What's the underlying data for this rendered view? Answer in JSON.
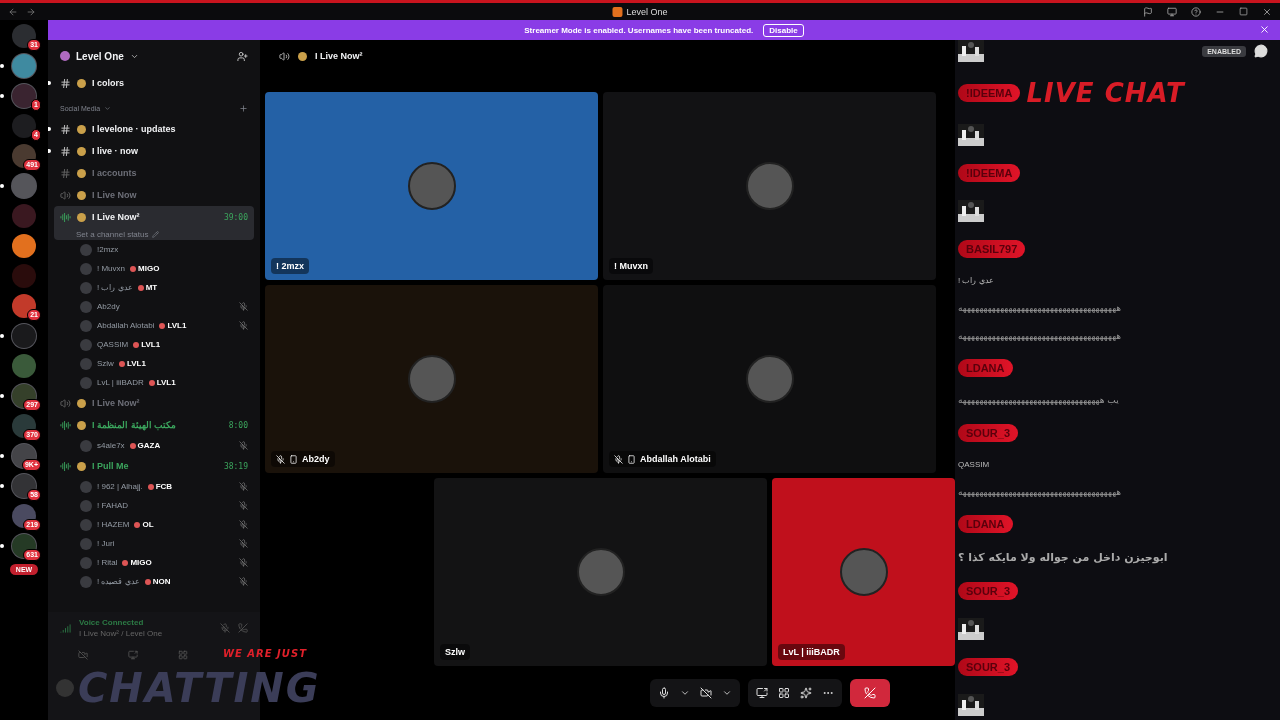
{
  "titlebar": {
    "title": "Level One"
  },
  "banner": {
    "message": "Streamer Mode is enabled. Usernames have been truncated.",
    "button": "Disable"
  },
  "servers": [
    {
      "badge": "31",
      "unread": false,
      "color": "#2b2d31"
    },
    {
      "unread": true,
      "color": "#3f8aa0"
    },
    {
      "badge": "1",
      "unread": true,
      "color": "#3a2430"
    },
    {
      "badge": "4",
      "unread": false,
      "color": "#1d1d20"
    },
    {
      "badge": "491",
      "unread": false,
      "color": "#4a3a30"
    },
    {
      "unread": true,
      "color": "#55555a"
    },
    {
      "unread": false,
      "color": "#3a1820"
    },
    {
      "unread": false,
      "color": "#e2701e"
    },
    {
      "unread": false,
      "color": "#2a0c0c"
    },
    {
      "badge": "21",
      "unread": false,
      "color": "#c23a2a"
    },
    {
      "unread": true,
      "color": "#1a1a1c"
    },
    {
      "unread": false,
      "color": "#3a5a3a"
    },
    {
      "badge": "297",
      "unread": true,
      "color": "#35402a"
    },
    {
      "badge": "370",
      "unread": false,
      "color": "#2a3a3a"
    },
    {
      "badge": "9K+",
      "unread": true,
      "color": "#444448"
    },
    {
      "badge": "58",
      "unread": true,
      "color": "#333336"
    },
    {
      "badge": "219",
      "unread": false,
      "color": "#4a4a60"
    },
    {
      "badge": "631",
      "unread": true,
      "color": "#253a25"
    }
  ],
  "servers_new": "NEW",
  "sidebar": {
    "server_name": "Level One",
    "channels": [
      {
        "kind": "text",
        "name": "I colors",
        "unread": true
      },
      {
        "kind": "category",
        "name": "Social Media"
      },
      {
        "kind": "text",
        "name": "I levelone · updates",
        "unread": true
      },
      {
        "kind": "text",
        "name": "I live · now",
        "unread": true
      },
      {
        "kind": "text",
        "name": "I accounts",
        "unread": false
      },
      {
        "kind": "voice",
        "name": "I Live Now",
        "active": false,
        "selected": false
      },
      {
        "kind": "voice",
        "name": "I Live Now²",
        "active": true,
        "selected": true,
        "timer": "39:00",
        "status": "Set a channel status",
        "members": [
          {
            "name": "!2mzx",
            "deafened": false
          },
          {
            "name": "! Muvxn",
            "tag": "MIGO",
            "deafened": false
          },
          {
            "name": "! عدي راب",
            "tag": "MT",
            "deafened": false
          },
          {
            "name": "Ab2dy",
            "deafened": true
          },
          {
            "name": "Abdallah Alotabi",
            "tag": "LVL1",
            "deafened": true
          },
          {
            "name": "QASSIM",
            "tag": "LVL1",
            "deafened": false
          },
          {
            "name": "Szlw",
            "tag": "LVL1",
            "deafened": false
          },
          {
            "name": "LvL | iiiBADR",
            "tag": "LVL1",
            "deafened": false
          }
        ]
      },
      {
        "kind": "voice",
        "name": "I Live Now²",
        "active": false,
        "selected": false
      },
      {
        "kind": "voice",
        "name": "I مكتب الهيئة المنظمة",
        "active": true,
        "selected": false,
        "timer": "8:00",
        "members": [
          {
            "name": "s4ale7x",
            "tag": "GAZA",
            "deafened": true
          }
        ]
      },
      {
        "kind": "voice",
        "name": "I Pull Me",
        "active": true,
        "selected": false,
        "timer": "38:19",
        "members": [
          {
            "name": "! 962 | Alhajj.",
            "tag": "FCB",
            "deafened": true
          },
          {
            "name": "! FAHAD",
            "deafened": true
          },
          {
            "name": "! HAZEM",
            "tag": "OL",
            "deafened": true
          },
          {
            "name": "! Juri",
            "deafened": true
          },
          {
            "name": "! Rital",
            "tag": "MIGO",
            "deafened": true
          },
          {
            "name": "! عدي قصيده",
            "tag": "NON",
            "deafened": true
          }
        ]
      }
    ],
    "voice_panel": {
      "status": "Voice Connected",
      "location": "I Live Now² / Level One"
    },
    "overlay": {
      "tagline": "WE ARE JUST",
      "title": "CHATTING"
    }
  },
  "main": {
    "channel": "I Live Now²",
    "rows": [
      {
        "tiles": [
          {
            "name": "! 2mzx",
            "color": "#2461a6",
            "muted": false,
            "mobile": false
          },
          {
            "name": "! Muvxn",
            "color": "#121214",
            "muted": false,
            "mobile": false
          }
        ]
      },
      {
        "tiles": [
          {
            "name": "Ab2dy",
            "color": "#1a120a",
            "muted": true,
            "mobile": true
          },
          {
            "name": "Abdallah Alotabi",
            "color": "#0f0f10",
            "muted": true,
            "mobile": true
          }
        ]
      },
      {
        "tiles": [
          {
            "name": "Szlw",
            "color": "#131314",
            "muted": false,
            "mobile": false
          },
          {
            "name": "LvL | iiiBADR",
            "color": "#c0101c",
            "muted": false,
            "mobile": false
          }
        ]
      }
    ]
  },
  "chat": {
    "badge": "ENABLED",
    "title": "LIVE CHAT",
    "entries": [
      {
        "kind": "sticker"
      },
      {
        "kind": "name",
        "text": "!IDEEMA"
      },
      {
        "kind": "sticker"
      },
      {
        "kind": "name",
        "text": "!IDEEMA"
      },
      {
        "kind": "sticker"
      },
      {
        "kind": "name",
        "text": "BASIL797"
      },
      {
        "kind": "label",
        "text": "! عدي راب"
      },
      {
        "kind": "laugh",
        "text": "ههههههههههههههههههههههههههههههههههههههه"
      },
      {
        "kind": "laugh",
        "text": "ههههههههههههههههههههههههههههههههههههههه"
      },
      {
        "kind": "name",
        "text": "LDANA"
      },
      {
        "kind": "laugh",
        "text": "يب ههههههههههههههههههههههههههههههههههه"
      },
      {
        "kind": "name",
        "text": "SOUR_3"
      },
      {
        "kind": "label",
        "text": "QASSIM"
      },
      {
        "kind": "laugh",
        "text": "ههههههههههههههههههههههههههههههههههههههه"
      },
      {
        "kind": "name",
        "text": "LDANA"
      },
      {
        "kind": "message",
        "text": "ابوجيزن داخل من جواله ولا مايكه كذا ؟"
      },
      {
        "kind": "name",
        "text": "SOUR_3"
      },
      {
        "kind": "sticker"
      },
      {
        "kind": "name",
        "text": "SOUR_3"
      },
      {
        "kind": "sticker"
      }
    ]
  }
}
